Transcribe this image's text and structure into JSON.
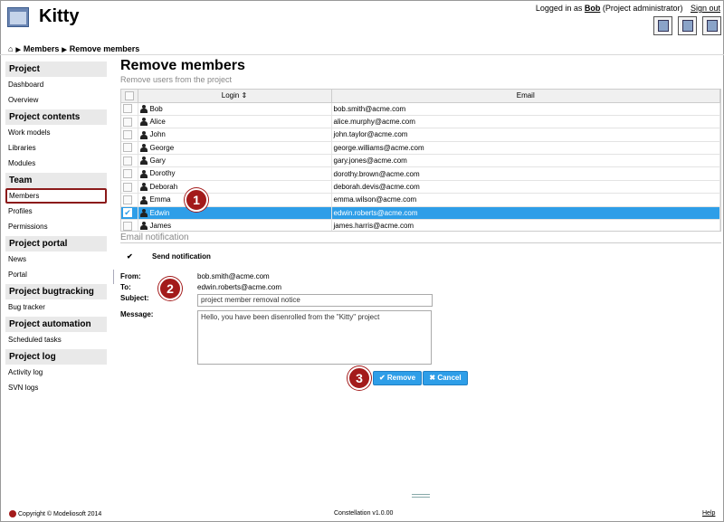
{
  "app": {
    "title": "Kitty"
  },
  "user": {
    "prefix": "Logged in as",
    "name": "Bob",
    "role": "(Project administrator)",
    "signout": "Sign out"
  },
  "header_icons": [
    "user-settings-icon",
    "user-group-icon",
    "user-screen-icon"
  ],
  "breadcrumb": {
    "home_icon": "home-icon",
    "items": [
      "Members",
      "Remove members"
    ]
  },
  "sidebar": {
    "sections": [
      {
        "title": "Project",
        "items": [
          "Dashboard",
          "Overview"
        ]
      },
      {
        "title": "Project contents",
        "items": [
          "Work models",
          "Libraries",
          "Modules"
        ]
      },
      {
        "title": "Team",
        "items": [
          "Members",
          "Profiles",
          "Permissions"
        ]
      },
      {
        "title": "Project portal",
        "items": [
          "News",
          "Portal"
        ]
      },
      {
        "title": "Project bugtracking",
        "items": [
          "Bug tracker"
        ]
      },
      {
        "title": "Project automation",
        "items": [
          "Scheduled tasks"
        ]
      },
      {
        "title": "Project log",
        "items": [
          "Activity log",
          "SVN logs"
        ]
      }
    ],
    "active_item": "Members"
  },
  "main": {
    "title": "Remove members",
    "subtitle": "Remove users from the project"
  },
  "table": {
    "columns": [
      "Login ⇕",
      "Email"
    ],
    "rows": [
      {
        "login": "Bob",
        "email": "bob.smith@acme.com",
        "selected": false
      },
      {
        "login": "Alice",
        "email": "alice.murphy@acme.com",
        "selected": false
      },
      {
        "login": "John",
        "email": "john.taylor@acme.com",
        "selected": false
      },
      {
        "login": "George",
        "email": "george.williams@acme.com",
        "selected": false
      },
      {
        "login": "Gary",
        "email": "gary.jones@acme.com",
        "selected": false
      },
      {
        "login": "Dorothy",
        "email": "dorothy.brown@acme.com",
        "selected": false
      },
      {
        "login": "Deborah",
        "email": "deborah.devis@acme.com",
        "selected": false
      },
      {
        "login": "Emma",
        "email": "emma.wilson@acme.com",
        "selected": false
      },
      {
        "login": "Edwin",
        "email": "edwin.roberts@acme.com",
        "selected": true
      },
      {
        "login": "James",
        "email": "james.harris@acme.com",
        "selected": false
      }
    ]
  },
  "notification": {
    "section_title": "Email notification",
    "send_label": "Send notification",
    "send_checked": true,
    "from_label": "From:",
    "from_value": "bob.smith@acme.com",
    "to_label": "To:",
    "to_value": "edwin.roberts@acme.com",
    "subject_label": "Subject:",
    "subject_value": "project member removal notice",
    "message_label": "Message:",
    "message_value": "Hello, you have been disenrolled from the \"Kitty\" project"
  },
  "actions": {
    "remove": "✔ Remove",
    "cancel": "✖ Cancel"
  },
  "markers": [
    "1",
    "2",
    "3"
  ],
  "footer": {
    "copyright": "Copyright © Modeliosoft 2014",
    "version": "Constellation v1.0.00",
    "help": "Help"
  },
  "colors": {
    "selected_row": "#2e9ee8",
    "button": "#2e9ee8",
    "marker": "#a31a1a",
    "active_border": "#8b1a1a"
  }
}
